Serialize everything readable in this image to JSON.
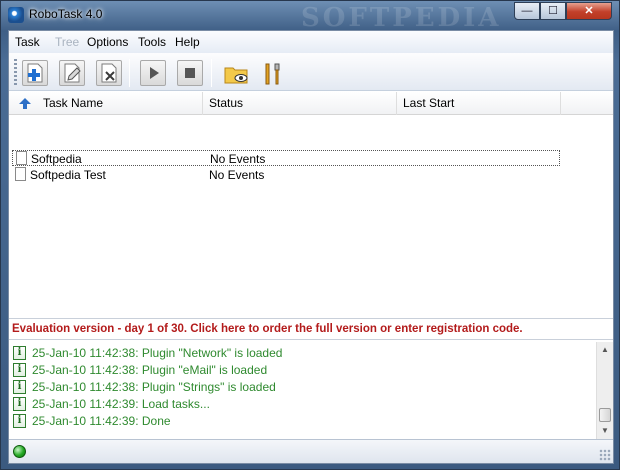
{
  "window": {
    "title": "RoboTask 4.0",
    "watermark": "SOFTPEDIA"
  },
  "title_buttons": {
    "minimize": "—",
    "maximize": "☐",
    "close": "✕"
  },
  "menu": [
    {
      "label": "Task",
      "enabled": true
    },
    {
      "label": "Tree",
      "enabled": false
    },
    {
      "label": "Options",
      "enabled": true
    },
    {
      "label": "Tools",
      "enabled": true
    },
    {
      "label": "Help",
      "enabled": true
    }
  ],
  "toolbar": {
    "buttons": [
      "new-task-icon",
      "edit-task-icon",
      "delete-task-icon",
      "run-task-icon",
      "stop-task-icon",
      "open-folder-icon",
      "settings-icon"
    ]
  },
  "list": {
    "columns": [
      "Task Name",
      "Status",
      "Last Start"
    ],
    "rows": [
      {
        "name": "Softpedia",
        "status": "No Events",
        "last_start": ""
      },
      {
        "name": "Softpedia Test",
        "status": "No Events",
        "last_start": ""
      }
    ]
  },
  "eval_notice": "Evaluation version - day 1 of 30. Click here to order the full version or enter registration code.",
  "log": [
    "25-Jan-10 11:42:38: Plugin \"Network\" is loaded",
    "25-Jan-10 11:42:38: Plugin \"eMail\" is loaded",
    "25-Jan-10 11:42:38: Plugin \"Strings\" is loaded",
    "25-Jan-10 11:42:39: Load tasks...",
    "25-Jan-10 11:42:39: Done"
  ],
  "log_icon_glyph": "i",
  "colors": {
    "eval_text": "#b31b1b",
    "log_text": "#2f8a2f",
    "status_ok": "#23a823"
  }
}
